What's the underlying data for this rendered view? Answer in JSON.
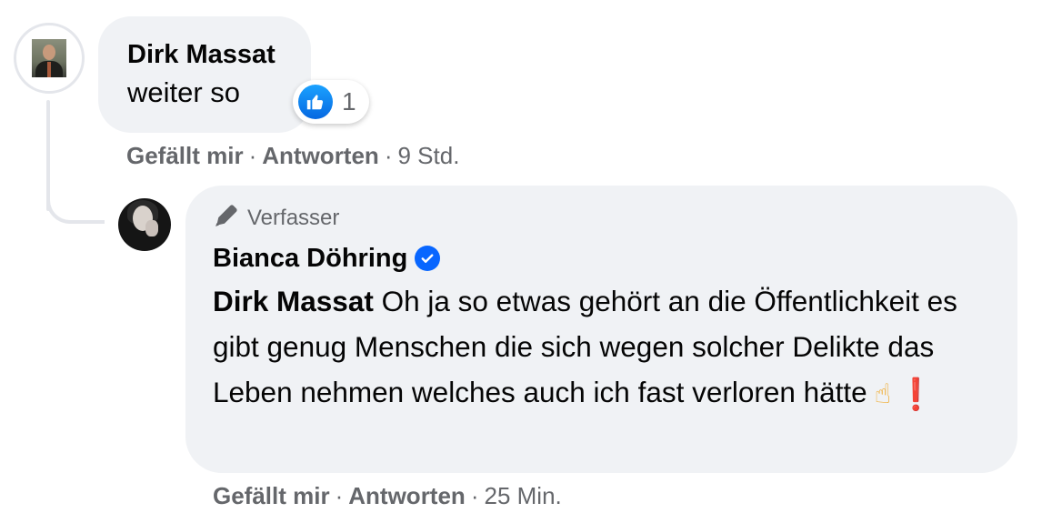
{
  "comment": {
    "author": "Dirk Massat",
    "text": "weiter so",
    "reaction_count": "1",
    "actions": {
      "like": "Gefällt mir",
      "reply": "Antworten",
      "time": "9 Std."
    }
  },
  "reply": {
    "badge": "Verfasser",
    "author": "Bianca Döhring",
    "mention": "Dirk Massat",
    "text": "Oh ja so etwas gehört an die Öffentlichkeit es gibt genug Menschen die sich wegen solcher Delikte das Leben nehmen welches auch ich fast verloren hätte",
    "emoji_1": "☝",
    "emoji_2": "❗",
    "actions": {
      "like": "Gefällt mir",
      "reply": "Antworten",
      "time": "25 Min."
    }
  },
  "icons": {
    "reaction": "like-thumb-icon",
    "badge": "pencil-icon",
    "verified": "verified-check-icon"
  },
  "colors": {
    "bubble": "#f0f2f5",
    "meta_text": "#65676b",
    "like_blue": "#0866ff",
    "exclamation_red": "#e0232e"
  }
}
